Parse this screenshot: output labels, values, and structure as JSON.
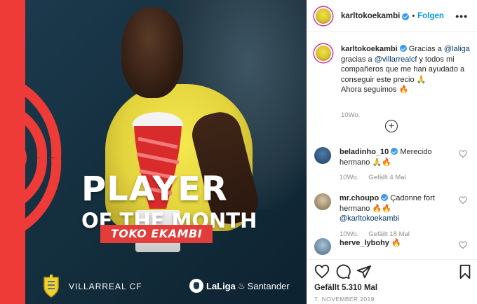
{
  "media": {
    "title_line1": "PLAYER",
    "title_line2": "OF THE MONTH",
    "player_name": "TOKO EKAMBI",
    "club_name": "VILLARREAL CF",
    "sponsor_brand": "LaLiga",
    "sponsor_partner": "Santander",
    "colors": {
      "accent_red": "#ee3b38",
      "shirt_yellow": "#f0e24a",
      "background": "#1d3a4f"
    }
  },
  "header": {
    "username": "karltokoekambi",
    "separator": "•",
    "follow_label": "Folgen",
    "more_icon": "more-horizontal-icon"
  },
  "caption": {
    "username": "karltokoekambi",
    "text_1": "Gracias a ",
    "mention_1": "@laliga",
    "text_2": " gracias a ",
    "mention_2": "@villarrealcf",
    "text_3": " y todos mi compañeros que me han ayudado a conseguir este precio 🙏",
    "text_4": "Ahora seguimos 🔥",
    "timestamp": "10Wo."
  },
  "load_more_icon": "plus-circle-icon",
  "comments": [
    {
      "username": "beladinho_10",
      "text": "Merecido hermano 🙏🔥",
      "timestamp": "10Wo.",
      "likes": "Gefällt 4 Mal"
    },
    {
      "username": "mr.choupo",
      "text_1": "Çadonne fort hermano 🔥🔥 ",
      "mention": "@karltokoekambi",
      "timestamp": "10Wo.",
      "likes": "Gefällt 18 Mal"
    },
    {
      "username": "herve_lybohy",
      "text": "🔥"
    }
  ],
  "actions": {
    "like_icon": "heart-icon",
    "comment_icon": "comment-icon",
    "share_icon": "send-icon",
    "save_icon": "bookmark-icon",
    "likes_count": "Gefällt 5.310 Mal",
    "date": "7. NOVEMBER 2019"
  }
}
